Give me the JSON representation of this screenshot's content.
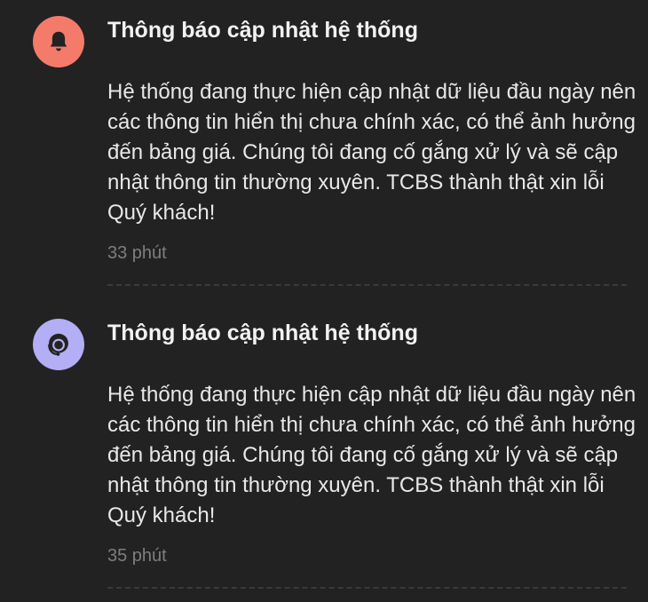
{
  "notifications": [
    {
      "icon": "bell-icon",
      "icon_bg": "#F47A6A",
      "title": "Thông báo cập nhật hệ thống",
      "body": "Hệ thống đang thực hiện cập nhật dữ liệu đầu ngày nên các thông tin hiển thị chưa chính xác, có thể ảnh hưởng đến bảng giá. Chúng tôi đang cố gắng xử lý và sẽ cập nhật thông tin thường xuyên. TCBS thành thật xin lỗi Quý khách!",
      "time": "33 phút"
    },
    {
      "icon": "support-agent-icon",
      "icon_bg": "#B3AEF5",
      "title": "Thông báo cập nhật hệ thống",
      "body": "Hệ thống đang thực hiện cập nhật dữ liệu đầu ngày nên các thông tin hiển thị chưa chính xác, có thể ảnh hưởng đến bảng giá. Chúng tôi đang cố gắng xử lý và sẽ cập nhật thông tin thường xuyên. TCBS thành thật xin lỗi Quý khách!",
      "time": "35 phút"
    }
  ]
}
